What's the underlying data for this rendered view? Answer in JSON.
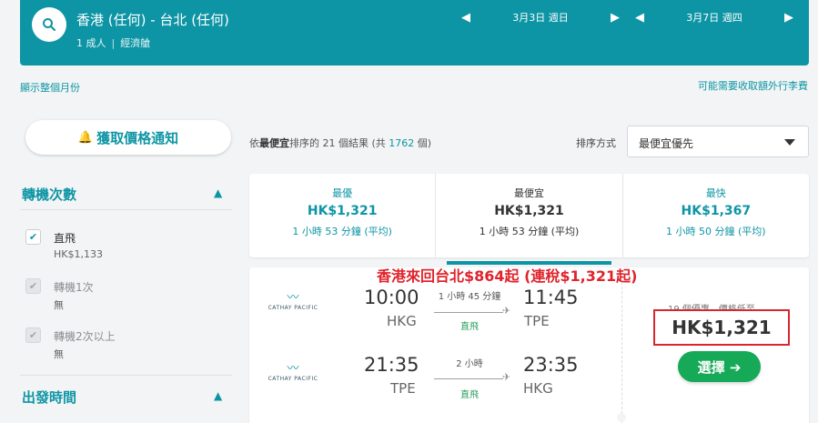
{
  "search": {
    "route": "香港 (任何) - 台北 (任何)",
    "passengers": "1 成人",
    "cabin": "經濟艙",
    "depart_date": "3月3日 週日",
    "return_date": "3月7日 週四"
  },
  "links": {
    "show_month": "顯示整個月份",
    "extra_fees": "可能需要收取額外行李費"
  },
  "sidebar": {
    "alert_label": "獲取價格通知",
    "stops": {
      "title": "轉機次數",
      "options": [
        {
          "label": "直飛",
          "price": "HK$1,133",
          "checked": true,
          "disabled": false
        },
        {
          "label": "轉機1次",
          "price": "無",
          "checked": true,
          "disabled": true
        },
        {
          "label": "轉機2次以上",
          "price": "無",
          "checked": true,
          "disabled": true
        }
      ]
    },
    "departure_time": {
      "title": "出發時間"
    }
  },
  "results": {
    "prefix": "依",
    "sort_key": "最便宜",
    "mid": "排序的 21 個結果 (共 ",
    "total": "1762",
    "suffix": " 個)",
    "sort_label": "排序方式",
    "sort_value": "最便宜優先"
  },
  "tabs": [
    {
      "title": "最優",
      "price": "HK$1,321",
      "duration": "1 小時 53 分鐘 (平均)",
      "active": false
    },
    {
      "title": "最便宜",
      "price": "HK$1,321",
      "duration": "1 小時 53 分鐘 (平均)",
      "active": true
    },
    {
      "title": "最快",
      "price": "HK$1,367",
      "duration": "1 小時 50 分鐘 (平均)",
      "active": false
    }
  ],
  "flight": {
    "airline": "CATHAY PACIFIC",
    "outbound": {
      "depart_time": "10:00",
      "depart_code": "HKG",
      "duration": "1 小時 45 分鐘",
      "stops": "直飛",
      "arrive_time": "11:45",
      "arrive_code": "TPE"
    },
    "inbound": {
      "depart_time": "21:35",
      "depart_code": "TPE",
      "duration": "2 小時",
      "stops": "直飛",
      "arrive_time": "23:35",
      "arrive_code": "HKG"
    },
    "deals": "19 個優惠，價格低至",
    "price": "HK$1,321",
    "select_label": "選擇 ➔"
  },
  "annotation": "香港來回台北$864起 (連稅$1,321起)",
  "colors": {
    "brand": "#0e95a5",
    "green": "#16a957",
    "red": "#d8262f"
  }
}
